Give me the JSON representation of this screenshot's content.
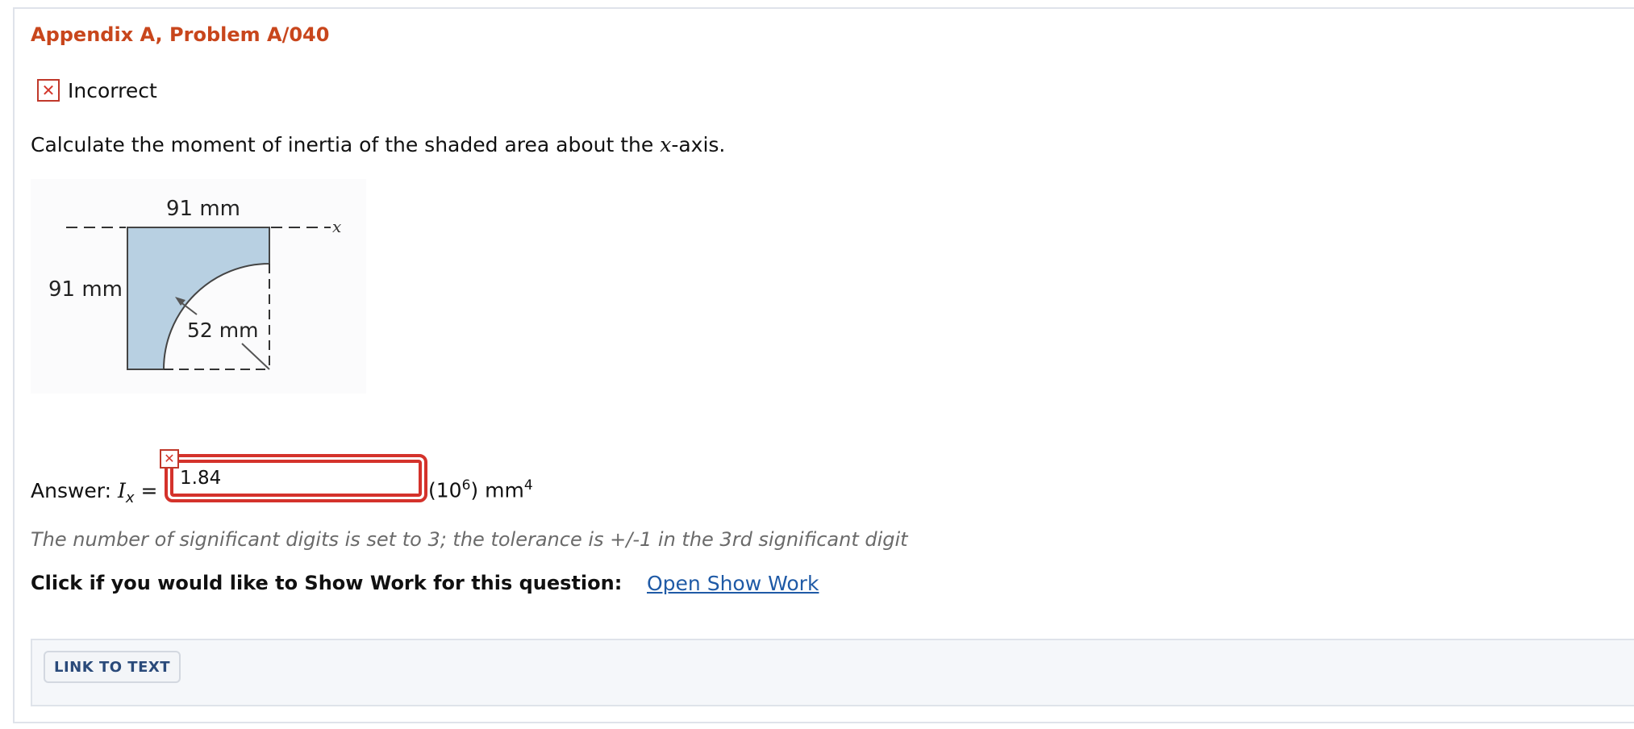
{
  "problem": {
    "title": "Appendix A, Problem A/040",
    "status_label": "Incorrect",
    "question_pre": "Calculate the moment of inertia of the shaded area about the ",
    "question_var": "x",
    "question_post": "-axis."
  },
  "figure": {
    "dim_width": "91 mm",
    "dim_height": "91 mm",
    "dim_radius": "52 mm",
    "axis_label": "x",
    "fill_color": "#b8d0e2"
  },
  "answer": {
    "label": "Answer: ",
    "var_main": "I",
    "var_sub": "x",
    "equals": " =",
    "value": "1.84",
    "units_pre": "(10",
    "units_exp": "6",
    "units_mid": ") mm",
    "units_exp2": "4"
  },
  "hint": "The number of significant digits is set to 3; the tolerance is +/-1 in the 3rd significant digit",
  "show_work": {
    "prompt": "Click if you would like to Show Work for this question:",
    "link_label": "Open Show Work"
  },
  "footer": {
    "link_to_text_label": "LINK TO TEXT"
  },
  "colors": {
    "title": "#c8461c",
    "error": "#d4322b",
    "link": "#1f5aa6"
  }
}
